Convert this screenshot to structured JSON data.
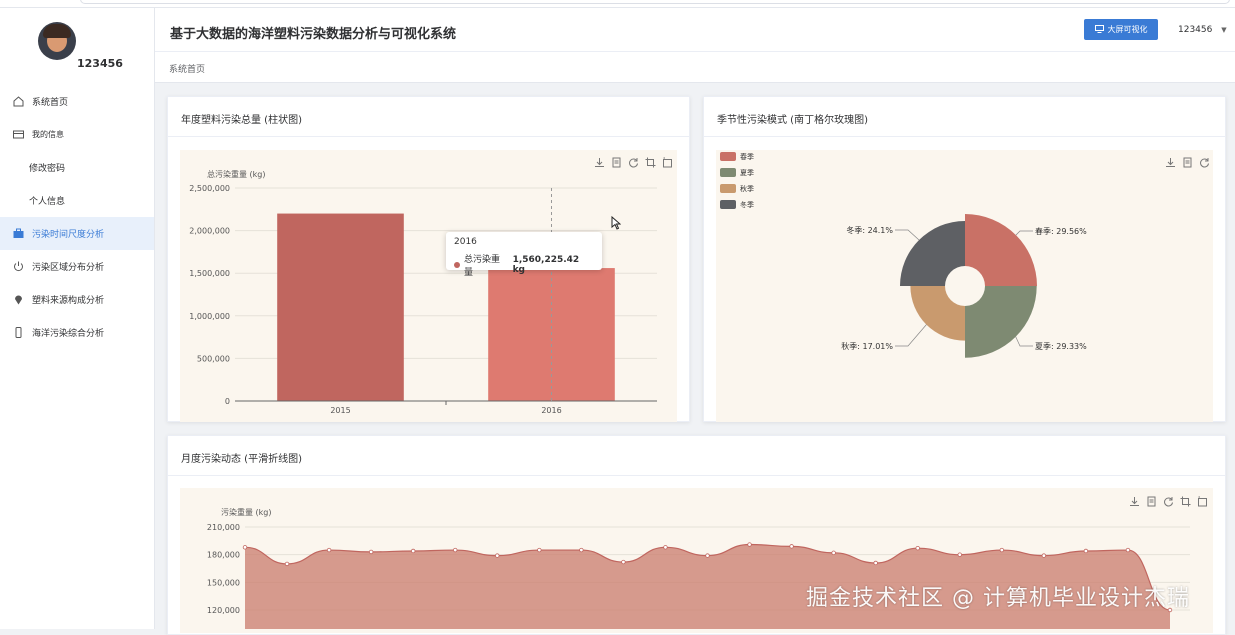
{
  "user": {
    "name": "123456"
  },
  "sidebar": {
    "items": [
      {
        "label": "系统首页",
        "icon": "home-icon"
      },
      {
        "label": "我的信息",
        "icon": "id-card-icon"
      },
      {
        "label": "修改密码"
      },
      {
        "label": "个人信息"
      },
      {
        "label": "污染时间尺度分析",
        "icon": "briefcase-icon"
      },
      {
        "label": "污染区域分布分析",
        "icon": "power-icon"
      },
      {
        "label": "塑料来源构成分析",
        "icon": "location-pin-icon"
      },
      {
        "label": "海洋污染综合分析",
        "icon": "phone-icon"
      }
    ]
  },
  "header": {
    "title": "基于大数据的海洋塑料污染数据分析与可视化系统",
    "bigscreen_label": "大屏可视化",
    "user_label": "123456"
  },
  "breadcrumb": "系统首页",
  "colors": {
    "accent": "#3a7bd5",
    "bar1": "#c0665f",
    "bar2": "#de7a70",
    "area": "#c97b6c",
    "chart_bg": "#fbf6ee"
  },
  "cards": {
    "bar": {
      "title": "年度塑料污染总量 (柱状图)"
    },
    "rose": {
      "title": "季节性污染模式 (南丁格尔玫瑰图)"
    },
    "line": {
      "title": "月度污染动态 (平滑折线图)"
    }
  },
  "tooltip": {
    "title": "2016",
    "series": "总污染重量",
    "value": "1,560,225.42 kg"
  },
  "chart_data": [
    {
      "type": "bar",
      "title": "",
      "ylabel": "总污染重量 (kg)",
      "categories": [
        "2015",
        "2016"
      ],
      "values": [
        2200000,
        1560225.42
      ],
      "ylim": [
        0,
        2500000
      ],
      "yticks": [
        "0",
        "500,000",
        "1,000,000",
        "1,500,000",
        "2,000,000",
        "2,500,000"
      ],
      "grid": true
    },
    {
      "type": "pie",
      "subtype": "rose",
      "legend": [
        "春季",
        "夏季",
        "秋季",
        "冬季"
      ],
      "legend_position": "top-left",
      "slices": [
        {
          "name": "春季",
          "value": 29.56,
          "label": "春季: 29.56%",
          "color": "#c97166"
        },
        {
          "name": "夏季",
          "value": 29.33,
          "label": "夏季: 29.33%",
          "color": "#7e8a72"
        },
        {
          "name": "秋季",
          "value": 17.01,
          "label": "秋季: 17.01%",
          "color": "#c99a6e"
        },
        {
          "name": "冬季",
          "value": 24.1,
          "label": "冬季: 24.1%",
          "color": "#5e6064"
        }
      ]
    },
    {
      "type": "area",
      "ylabel": "污染重量 (kg)",
      "ylim": [
        120000,
        210000
      ],
      "yticks": [
        "120,000",
        "150,000",
        "180,000",
        "210,000"
      ],
      "values": [
        188000,
        170000,
        185000,
        183000,
        184000,
        185000,
        179000,
        185000,
        185000,
        172000,
        188000,
        179000,
        191000,
        189000,
        182000,
        171000,
        187000,
        180000,
        185000,
        179000,
        184000,
        185000,
        120000
      ]
    }
  ],
  "watermark": "掘金技术社区 @ 计算机毕业设计杰瑞"
}
